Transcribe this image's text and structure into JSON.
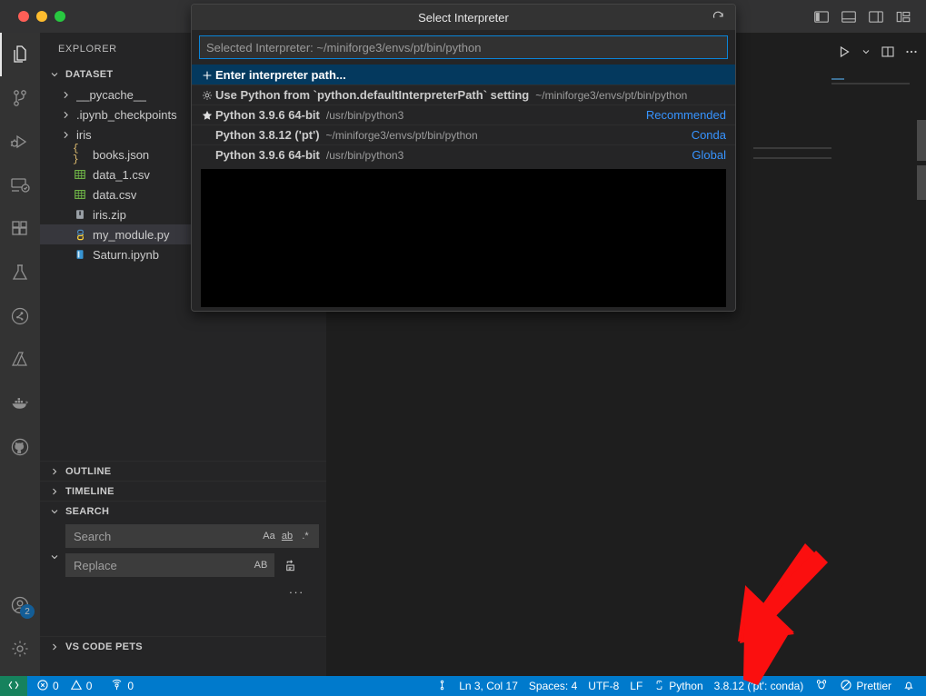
{
  "window": {
    "traffic_lights": [
      "close",
      "minimize",
      "zoom"
    ],
    "layout_buttons": [
      {
        "name": "toggle-primary-sidebar",
        "label": "Toggle Primary Side Bar"
      },
      {
        "name": "toggle-panel",
        "label": "Toggle Panel"
      },
      {
        "name": "toggle-secondary-sidebar",
        "label": "Toggle Secondary Side Bar"
      },
      {
        "name": "customize-layout",
        "label": "Customize Layout"
      }
    ]
  },
  "activity_bar": {
    "items": [
      {
        "id": "explorer",
        "label": "Explorer",
        "icon": "files-icon",
        "active": true
      },
      {
        "id": "source-control",
        "label": "Source Control",
        "icon": "source-control-icon",
        "active": false
      },
      {
        "id": "run-debug",
        "label": "Run and Debug",
        "icon": "debug-icon",
        "active": false
      },
      {
        "id": "remote-explorer",
        "label": "Remote Explorer",
        "icon": "remote-icon",
        "active": false
      },
      {
        "id": "extensions",
        "label": "Extensions",
        "icon": "extensions-icon",
        "active": false
      },
      {
        "id": "testing",
        "label": "Testing",
        "icon": "beaker-icon",
        "active": false
      },
      {
        "id": "jupyter",
        "label": "Jupyter",
        "icon": "jupyter-icon",
        "active": false
      },
      {
        "id": "azure",
        "label": "Azure",
        "icon": "azure-icon",
        "active": false
      },
      {
        "id": "docker",
        "label": "Docker",
        "icon": "docker-icon",
        "active": false
      },
      {
        "id": "github",
        "label": "GitHub",
        "icon": "github-icon",
        "active": false
      }
    ],
    "bottom": [
      {
        "id": "accounts",
        "label": "Accounts",
        "icon": "account-icon",
        "badge": "2"
      },
      {
        "id": "settings",
        "label": "Manage",
        "icon": "gear-icon",
        "badge": ""
      }
    ]
  },
  "sidebar": {
    "title": "EXPLORER",
    "folder": {
      "label": "DATASET",
      "expanded": true,
      "chevron": "chevron-down-icon"
    },
    "files": [
      {
        "name": "__pycache__",
        "type": "folder",
        "icon": "chevron-right-icon",
        "selected": false,
        "indent": 1
      },
      {
        "name": ".ipynb_checkpoints",
        "type": "folder",
        "icon": "chevron-right-icon",
        "selected": false,
        "indent": 1
      },
      {
        "name": "iris",
        "type": "folder",
        "icon": "chevron-right-icon",
        "selected": false,
        "indent": 1
      },
      {
        "name": "books.json",
        "type": "json",
        "icon": "json-icon",
        "selected": false,
        "indent": 1
      },
      {
        "name": "data_1.csv",
        "type": "csv",
        "icon": "csv-icon",
        "selected": false,
        "indent": 1
      },
      {
        "name": "data.csv",
        "type": "csv",
        "icon": "csv-icon",
        "selected": false,
        "indent": 1
      },
      {
        "name": "iris.zip",
        "type": "zip",
        "icon": "zip-icon",
        "selected": false,
        "indent": 1
      },
      {
        "name": "my_module.py",
        "type": "python",
        "icon": "python-icon",
        "selected": true,
        "indent": 1
      },
      {
        "name": "Saturn.ipynb",
        "type": "notebook",
        "icon": "notebook-icon",
        "selected": false,
        "indent": 1
      }
    ],
    "sections": [
      {
        "label": "OUTLINE",
        "expanded": false,
        "chevron": "chevron-right-icon"
      },
      {
        "label": "TIMELINE",
        "expanded": false,
        "chevron": "chevron-right-icon"
      },
      {
        "label": "SEARCH",
        "expanded": true,
        "chevron": "chevron-down-icon"
      },
      {
        "label": "VS CODE PETS",
        "expanded": false,
        "chevron": "chevron-right-icon"
      }
    ],
    "search": {
      "toggle_icon": "chevron-down-icon",
      "search_placeholder": "Search",
      "search_value": "",
      "replace_placeholder": "Replace",
      "replace_value": "",
      "match_case_label": "Aa",
      "whole_word_label": "ab",
      "regex_label": ".*",
      "preserve_case_label": "AB",
      "replace_all_icon": "replace-all-icon",
      "more_actions_label": "..."
    }
  },
  "editor": {
    "actions": [
      {
        "name": "run-python-file",
        "icon": "play-icon"
      },
      {
        "name": "run-menu-dropdown",
        "icon": "chevron-down-icon"
      },
      {
        "name": "split-editor-right",
        "icon": "split-editor-icon"
      },
      {
        "name": "more-actions",
        "icon": "ellipsis-icon"
      }
    ]
  },
  "quick_pick": {
    "title": "Select Interpreter",
    "refresh_icon": "refresh-icon",
    "input_placeholder": "Selected Interpreter: ~/miniforge3/envs/pt/bin/python",
    "input_value": "",
    "items": [
      {
        "icon": "plus-icon",
        "label": "Enter interpreter path...",
        "description": "",
        "right": "",
        "focused": true
      },
      {
        "icon": "gear-icon",
        "label": "Use Python from `python.defaultInterpreterPath` setting",
        "description": "~/miniforge3/envs/pt/bin/python",
        "right": "",
        "focused": false
      },
      {
        "icon": "star-icon",
        "label": "Python 3.9.6 64-bit",
        "description": "/usr/bin/python3",
        "right": "Recommended",
        "focused": false
      },
      {
        "icon": "",
        "label": "Python 3.8.12 ('pt')",
        "description": "~/miniforge3/envs/pt/bin/python",
        "right": "Conda",
        "focused": false
      },
      {
        "icon": "",
        "label": "Python 3.9.6 64-bit",
        "description": "/usr/bin/python3",
        "right": "Global",
        "focused": false
      }
    ]
  },
  "status_bar": {
    "remote": {
      "icon": "remote-indicator-icon",
      "label": ""
    },
    "left_items": [
      {
        "name": "errors-count",
        "icon": "error-icon",
        "label": "0"
      },
      {
        "name": "warnings-count",
        "icon": "warning-icon",
        "label": "0"
      },
      {
        "name": "ports-count",
        "icon": "ports-icon",
        "label": "0"
      }
    ],
    "right_items": [
      {
        "name": "source-control-branch",
        "icon": "branch-icon",
        "label": ""
      },
      {
        "name": "editor-position",
        "icon": "",
        "label": "Ln 3, Col 17"
      },
      {
        "name": "editor-indentation",
        "icon": "",
        "label": "Spaces: 4"
      },
      {
        "name": "editor-encoding",
        "icon": "",
        "label": "UTF-8"
      },
      {
        "name": "editor-eol",
        "icon": "",
        "label": "LF"
      },
      {
        "name": "editor-language",
        "icon": "python-icon",
        "label": "Python"
      },
      {
        "name": "python-interpreter",
        "icon": "",
        "label": "3.8.12 ('pt': conda)"
      },
      {
        "name": "vscode-pets",
        "icon": "pets-icon",
        "label": ""
      },
      {
        "name": "prettier-status",
        "icon": "prettier-icon",
        "label": "Prettier"
      },
      {
        "name": "notifications",
        "icon": "bell-icon",
        "label": ""
      }
    ]
  },
  "annotation": {
    "arrow_color": "#fb0f0f",
    "points_to": "python-interpreter"
  },
  "colors": {
    "accent": "#007acc",
    "focus_border": "#0a84d8",
    "selection": "#04395e",
    "link": "#3794ff",
    "remote_green": "#16825d"
  }
}
